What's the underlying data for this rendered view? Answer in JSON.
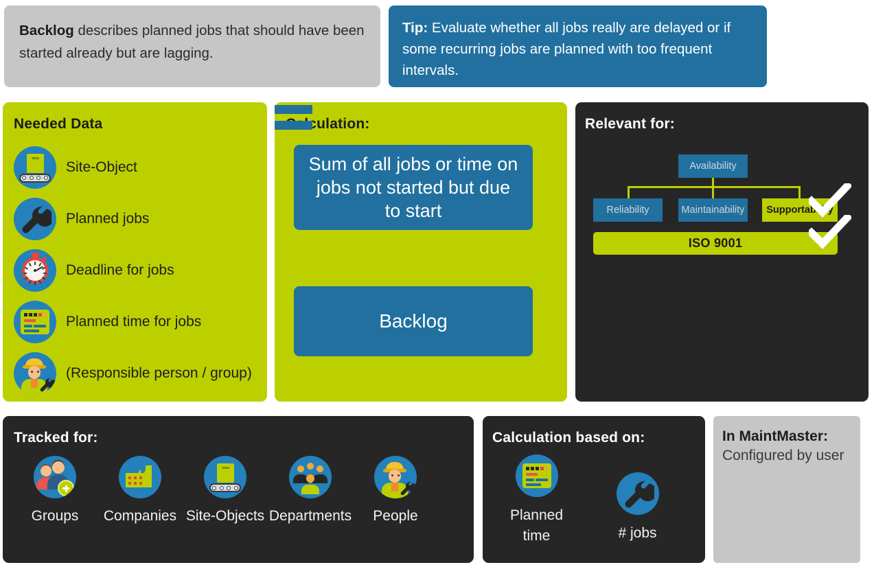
{
  "description": {
    "lead": "Backlog",
    "rest": " describes planned jobs that should have been started already but are lagging."
  },
  "tip": {
    "lead": "Tip:",
    "rest": " Evaluate whether all jobs really are delayed or if some recurring jobs are planned with too frequent intervals."
  },
  "needed_data": {
    "title": "Needed Data",
    "items": [
      {
        "label": "Site-Object",
        "icon": "site-object-icon"
      },
      {
        "label": "Planned jobs",
        "icon": "wrench-icon"
      },
      {
        "label": "Deadline for jobs",
        "icon": "stopwatch-icon"
      },
      {
        "label": "Planned time for jobs",
        "icon": "schedule-card-icon"
      },
      {
        "label": "(Responsible person / group)",
        "icon": "worker-icon"
      }
    ]
  },
  "calculation": {
    "title": "Calculation:",
    "numerator": "Sum of all jobs or time on jobs not started but due to start",
    "operator": "=",
    "result": "Backlog"
  },
  "relevant": {
    "title": "Relevant for:",
    "nodes": {
      "availability": "Availability",
      "reliability": "Reliability",
      "maintainability": "Maintainability",
      "supportability": "Supportability",
      "iso": "ISO 9001"
    },
    "checked": [
      "Supportability",
      "ISO 9001"
    ]
  },
  "tracked": {
    "title": "Tracked for:",
    "items": [
      {
        "label": "Groups",
        "icon": "people-add-icon"
      },
      {
        "label": "Companies",
        "icon": "factory-icon"
      },
      {
        "label": "Site-Objects",
        "icon": "site-object-icon"
      },
      {
        "label": "Departments",
        "icon": "people-group-icon"
      },
      {
        "label": "People",
        "icon": "worker-icon"
      }
    ]
  },
  "calc_based_on": {
    "title": "Calculation based on:",
    "items": [
      {
        "label": "Planned time",
        "icon": "schedule-card-icon"
      },
      {
        "label": "# jobs",
        "icon": "wrench-icon"
      }
    ]
  },
  "maintmaster": {
    "title": "In MaintMaster:",
    "value": "Configured by user"
  },
  "colors": {
    "green": "#bcd000",
    "blue": "#21709f",
    "dark": "#262626",
    "gray": "#c6c6c6",
    "icon_blue": "#2481bb"
  }
}
